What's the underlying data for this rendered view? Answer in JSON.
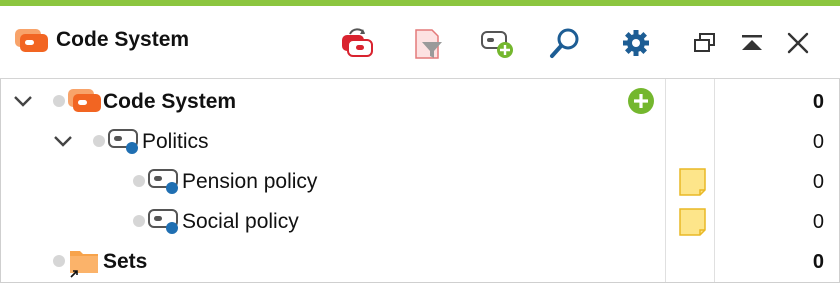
{
  "header": {
    "title": "Code System"
  },
  "toolbar": {
    "buttons": [
      {
        "icon": "reset-code-frequencies-icon"
      },
      {
        "icon": "filter-code-icon"
      },
      {
        "icon": "new-code-icon"
      },
      {
        "icon": "search-icon"
      },
      {
        "icon": "settings-icon"
      },
      {
        "icon": "undock-window-icon"
      },
      {
        "icon": "collapse-window-icon"
      },
      {
        "icon": "close-icon"
      }
    ]
  },
  "tree": {
    "rows": [
      {
        "label": "Code System",
        "count": "0",
        "bold": true,
        "icon": "code-system-icon",
        "expanded": true
      },
      {
        "label": "Politics",
        "count": "0",
        "bold": false,
        "icon": "code-icon",
        "expanded": true
      },
      {
        "label": "Pension policy",
        "count": "0",
        "bold": false,
        "icon": "code-icon",
        "memo": true
      },
      {
        "label": "Social policy",
        "count": "0",
        "bold": false,
        "icon": "code-icon",
        "memo": true
      },
      {
        "label": "Sets",
        "count": "0",
        "bold": true,
        "icon": "sets-folder-icon"
      }
    ]
  },
  "colors": {
    "accent_green": "#8cc63f",
    "code_blue": "#1f6fb2",
    "code_system_orange": "#f26522",
    "memo_yellow": "#fde58a",
    "settings_blue": "#1d5d94"
  }
}
